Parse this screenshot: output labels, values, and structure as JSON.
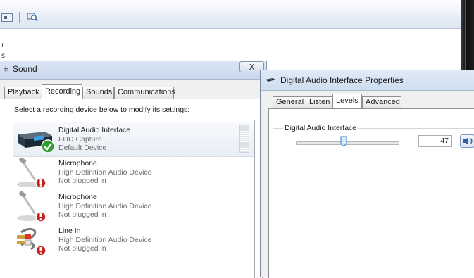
{
  "background_window": {
    "side_letters": [
      "r",
      "s"
    ]
  },
  "sound_window": {
    "title": "Sound",
    "close_label": "X",
    "tabs": [
      {
        "label": "Playback",
        "active": false
      },
      {
        "label": "Recording",
        "active": true
      },
      {
        "label": "Sounds",
        "active": false
      },
      {
        "label": "Communications",
        "active": false
      }
    ],
    "instruction": "Select a recording device below to modify its settings:",
    "devices": [
      {
        "name": "Digital Audio Interface",
        "line1": "FHD Capture",
        "line2": "Default Device",
        "icon": "capture-device-icon",
        "status_icon": "default-check-icon",
        "selected": true
      },
      {
        "name": "Microphone",
        "line1": "High Definition Audio Device",
        "line2": "Not plugged in",
        "icon": "microphone-icon",
        "status_icon": "unplugged-icon",
        "selected": false
      },
      {
        "name": "Microphone",
        "line1": "High Definition Audio Device",
        "line2": "Not plugged in",
        "icon": "microphone-icon",
        "status_icon": "unplugged-icon",
        "selected": false
      },
      {
        "name": "Line In",
        "line1": "High Definition Audio Device",
        "line2": "Not plugged in",
        "icon": "line-in-cable-icon",
        "status_icon": "unplugged-icon",
        "selected": false
      }
    ]
  },
  "properties_window": {
    "title": "Digital Audio Interface Properties",
    "tabs": [
      {
        "label": "General",
        "active": false
      },
      {
        "label": "Listen",
        "active": false
      },
      {
        "label": "Levels",
        "active": true
      },
      {
        "label": "Advanced",
        "active": false
      }
    ],
    "group_label": "Digital Audio Interface",
    "level_value": "47",
    "level_fraction": 0.47,
    "speaker_icon": "speaker-icon"
  },
  "colors": {
    "title_bar": "#cddcef",
    "selection": "#e9eef5",
    "accent_blue": "#3c7fc9",
    "unplugged_red": "#c4231f",
    "default_green": "#2f9e2f"
  }
}
